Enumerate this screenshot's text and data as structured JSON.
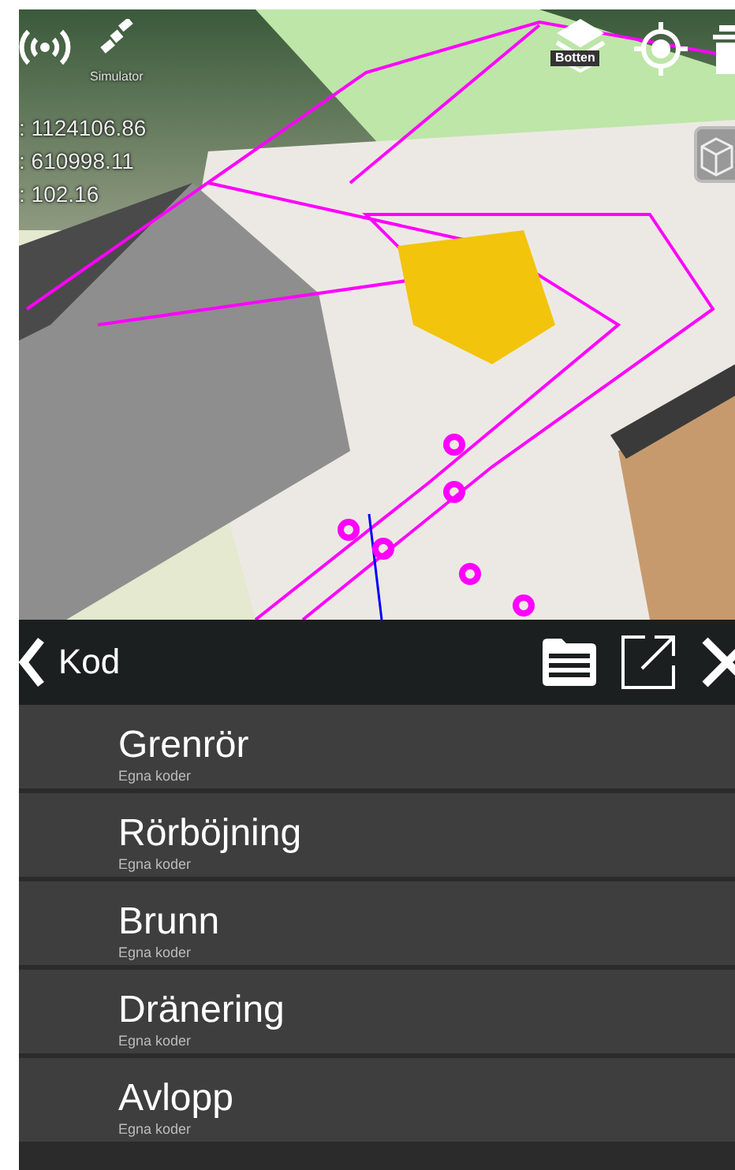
{
  "map": {
    "simulator_label": "Simulator",
    "layer_label": "Botten",
    "coordinates": [
      ": 1124106.86",
      ": 610998.11",
      ": 102.16"
    ]
  },
  "header": {
    "title": "Kod"
  },
  "items": [
    {
      "title": "Grenrör",
      "subtitle": "Egna koder"
    },
    {
      "title": "Rörböjning",
      "subtitle": "Egna koder"
    },
    {
      "title": "Brunn",
      "subtitle": "Egna koder"
    },
    {
      "title": "Dränering",
      "subtitle": "Egna koder"
    },
    {
      "title": "Avlopp",
      "subtitle": "Egna koder"
    }
  ]
}
